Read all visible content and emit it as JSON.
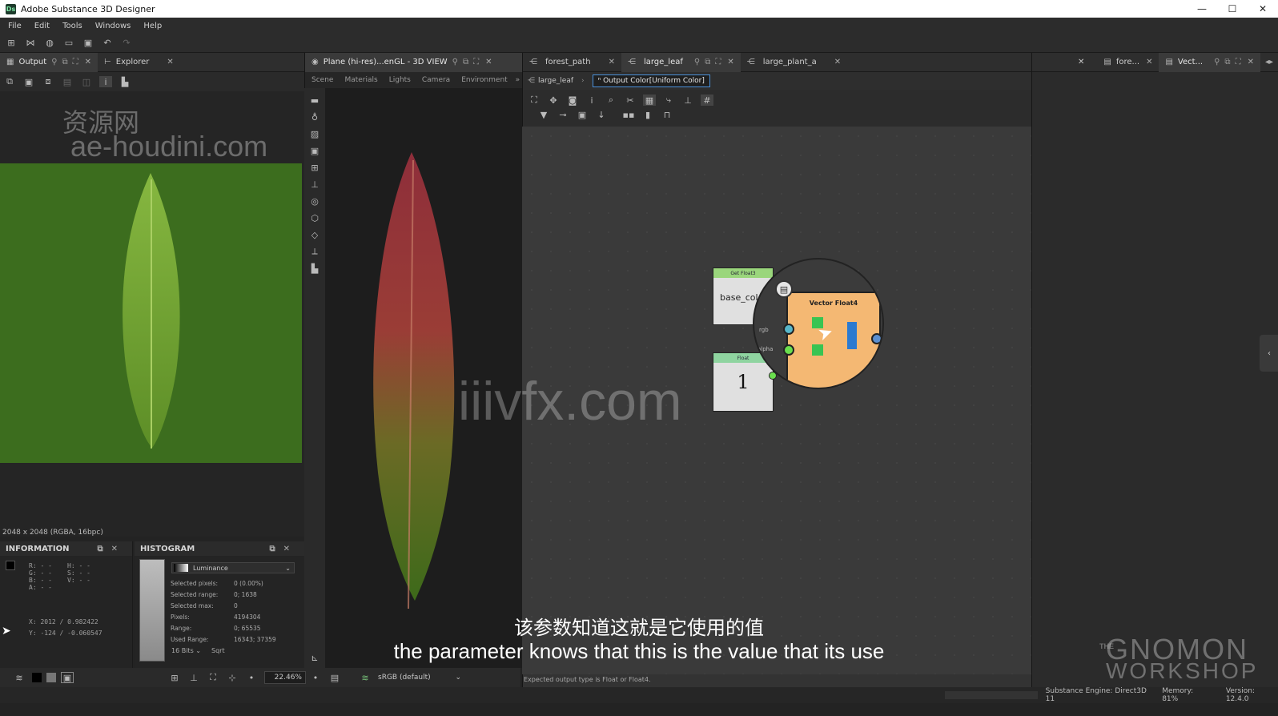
{
  "window": {
    "title": "Adobe Substance 3D Designer",
    "logo": "Ds",
    "min": "—",
    "max": "☐",
    "close": "✕"
  },
  "menu": [
    "File",
    "Edit",
    "Tools",
    "Windows",
    "Help"
  ],
  "output_panel": {
    "tabs": [
      {
        "label": "Output"
      },
      {
        "label": "Explorer"
      }
    ],
    "resolution": "2048 x 2048 (RGBA, 16bpc)"
  },
  "info_panel": {
    "title": "INFORMATION",
    "rows": [
      "R: - -",
      "G: - -",
      "B: - -",
      "A: - -",
      "H: - -",
      "S: - -",
      "V: - -"
    ],
    "coords_x": "X:  2012 / 0.982422",
    "coords_y": "Y:  -124 / -0.060547"
  },
  "histogram_panel": {
    "title": "HISTOGRAM",
    "mode": "Luminance",
    "stats": [
      {
        "k": "Selected pixels:",
        "v": "0 (0.00%)"
      },
      {
        "k": "Selected range:",
        "v": "0; 1638"
      },
      {
        "k": "Selected max:",
        "v": "0"
      },
      {
        "k": "Pixels:",
        "v": "4194304"
      },
      {
        "k": "Range:",
        "v": "0; 65535"
      },
      {
        "k": "Used Range:",
        "v": "16343; 37359"
      }
    ],
    "bits": "16 Bits",
    "sqrt": "Sqrt"
  },
  "bottom_left": {
    "zoom": "22.46%",
    "colorspace": "sRGB (default)"
  },
  "view3d": {
    "title": "Plane (hi-res)...enGL - 3D VIEW",
    "menus": [
      "Scene",
      "Materials",
      "Lights",
      "Camera",
      "Environment"
    ]
  },
  "graph": {
    "tabs": [
      {
        "label": "forest_path"
      },
      {
        "label": "large_leaf"
      },
      {
        "label": "large_plant_a"
      }
    ],
    "breadcrumb_root": "large_leaf",
    "breadcrumb_current": "Output Color[Uniform Color]",
    "node_get": {
      "header": "Get Float3",
      "label": "base_colo"
    },
    "node_float": {
      "header": "Float",
      "value": "1"
    },
    "node_vector": {
      "title": "Vector Float4",
      "port_rgb": "rgb",
      "port_alpha": "alpha"
    },
    "status": "Expected output type is Float or Float4."
  },
  "right_tabs": [
    {
      "label": "fore..."
    },
    {
      "label": "Vect..."
    }
  ],
  "status_right": {
    "engine": "Substance Engine: Direct3D 11",
    "memory": "Memory: 81%",
    "version": "Version: 12.4.0"
  },
  "subtitle": {
    "cn": "该参数知道这就是它使用的值",
    "en": "the parameter knows that this is the value that its use"
  },
  "watermarks": {
    "site_cn": "资源网",
    "site_a": "ae-houdini.com",
    "site_b": "iiivfx.com",
    "brand_a": "THE",
    "brand_b": "GNOMON",
    "brand_c": "WORKSHOP"
  },
  "colors": {
    "accent": "#3d8fe0",
    "leaf_bg": "#3c6d1e",
    "node_orange": "#f4b873"
  }
}
